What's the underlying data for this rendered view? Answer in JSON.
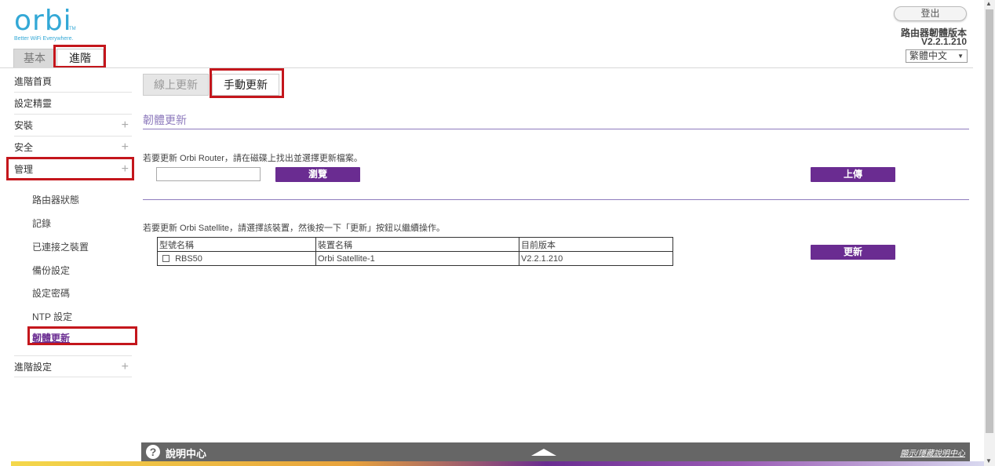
{
  "brand": {
    "logo": "orbi",
    "tm": "TM",
    "tagline": "Better WiFi Everywhere."
  },
  "top_tabs": {
    "basic": "基本",
    "advanced": "進階"
  },
  "header": {
    "logout": "登出",
    "firmware_label": "路由器韌體版本",
    "firmware_version": "V2.2.1.210",
    "language": "繁體中文"
  },
  "sidebar": {
    "items": [
      {
        "label": "進階首頁",
        "expandable": false
      },
      {
        "label": "設定精靈",
        "expandable": false
      },
      {
        "label": "安裝",
        "expandable": true
      },
      {
        "label": "安全",
        "expandable": true
      },
      {
        "label": "管理",
        "expandable": true
      }
    ],
    "sub_items": [
      "路由器狀態",
      "記錄",
      "已連接之裝置",
      "備份設定",
      "設定密碼",
      "NTP 設定"
    ],
    "active_sub": "韌體更新",
    "advanced_settings": "進階設定",
    "plus": "+"
  },
  "subtabs": {
    "online": "線上更新",
    "manual": "手動更新"
  },
  "main": {
    "section_title": "韌體更新",
    "router_instruction": "若要更新 Orbi Router，請在磁碟上找出並選擇更新檔案。",
    "browse_button": "瀏覽",
    "upload_button": "上傳",
    "satellite_instruction": "若要更新 Orbi Satellite，請選擇該裝置，然後按一下「更新」按鈕以繼續操作。",
    "table_headers": [
      "型號名稱",
      "裝置名稱",
      "目前版本"
    ],
    "table_rows": [
      {
        "model": "RBS50",
        "device": "Orbi Satellite-1",
        "version": "V2.2.1.210",
        "checked": false
      }
    ],
    "update_button": "更新"
  },
  "footer": {
    "help_icon": "?",
    "help_center": "說明中心",
    "help_link": "顯示/隱藏說明中心"
  },
  "colors": {
    "accent": "#6a2c91",
    "brand_blue": "#33a8d6",
    "highlight_red": "#c4161c"
  }
}
